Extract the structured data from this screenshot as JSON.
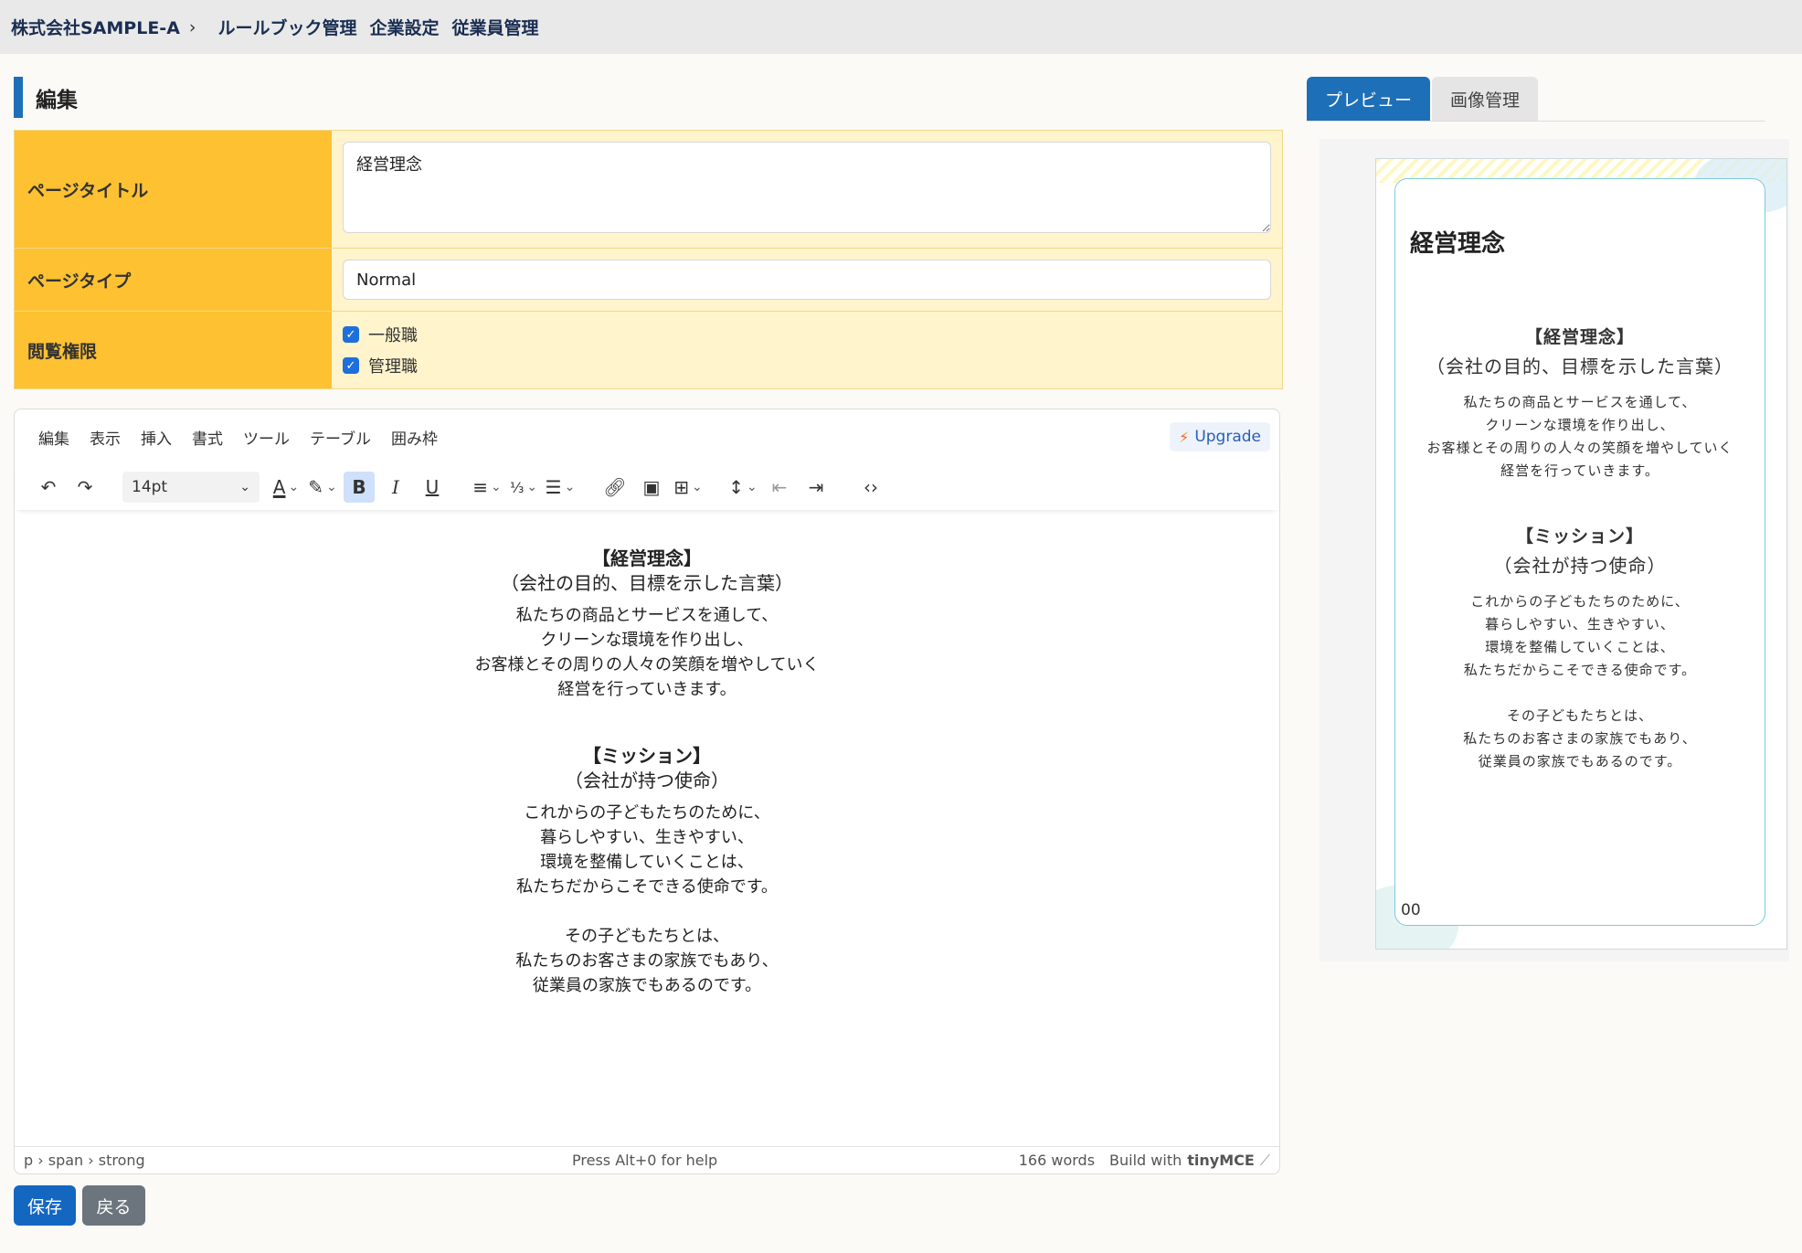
{
  "header": {
    "company": "株式会社SAMPLE-A",
    "chevron": "›",
    "nav": [
      "ルールブック管理",
      "企業設定",
      "従業員管理"
    ]
  },
  "section_title": "編集",
  "form": {
    "page_title_label": "ページタイトル",
    "page_title_value": "経営理念",
    "page_type_label": "ページタイプ",
    "page_type_value": "Normal",
    "permission_label": "閲覧権限",
    "permissions": [
      {
        "label": "一般職",
        "checked": true
      },
      {
        "label": "管理職",
        "checked": true
      }
    ]
  },
  "editor": {
    "menu": [
      "編集",
      "表示",
      "挿入",
      "書式",
      "ツール",
      "テーブル",
      "囲み枠"
    ],
    "upgrade": "Upgrade",
    "font_size": "14pt",
    "content": {
      "h1": "【経営理念】",
      "sub1": "（会社の目的、目標を示した言葉）",
      "p1": [
        "私たちの商品とサービスを通して、",
        "クリーンな環境を作り出し、",
        "お客様とその周りの人々の笑顔を増やしていく",
        "経営を行っていきます。"
      ],
      "h2": "【ミッション】",
      "sub2": "（会社が持つ使命）",
      "p2": [
        "これからの子どもたちのために、",
        "暮らしやすい、生きやすい、",
        "環境を整備していくことは、",
        "私たちだからこそできる使命です。"
      ],
      "p3": [
        "その子どもたちとは、",
        "私たちのお客さまの家族でもあり、",
        "従業員の家族でもあるのです。"
      ]
    },
    "status": {
      "path": "p › span › strong",
      "help": "Press Alt+0 for help",
      "words": "166 words",
      "build": "Build with",
      "brand": "tinyMCE"
    }
  },
  "buttons": {
    "save": "保存",
    "back": "戻る"
  },
  "right": {
    "tabs": [
      "プレビュー",
      "画像管理"
    ],
    "preview": {
      "title": "経営理念",
      "page_no": "00"
    }
  },
  "colors": {
    "accent": "#1d6fb8",
    "label_bg": "#fdc132",
    "field_bg": "#fff4cc"
  }
}
